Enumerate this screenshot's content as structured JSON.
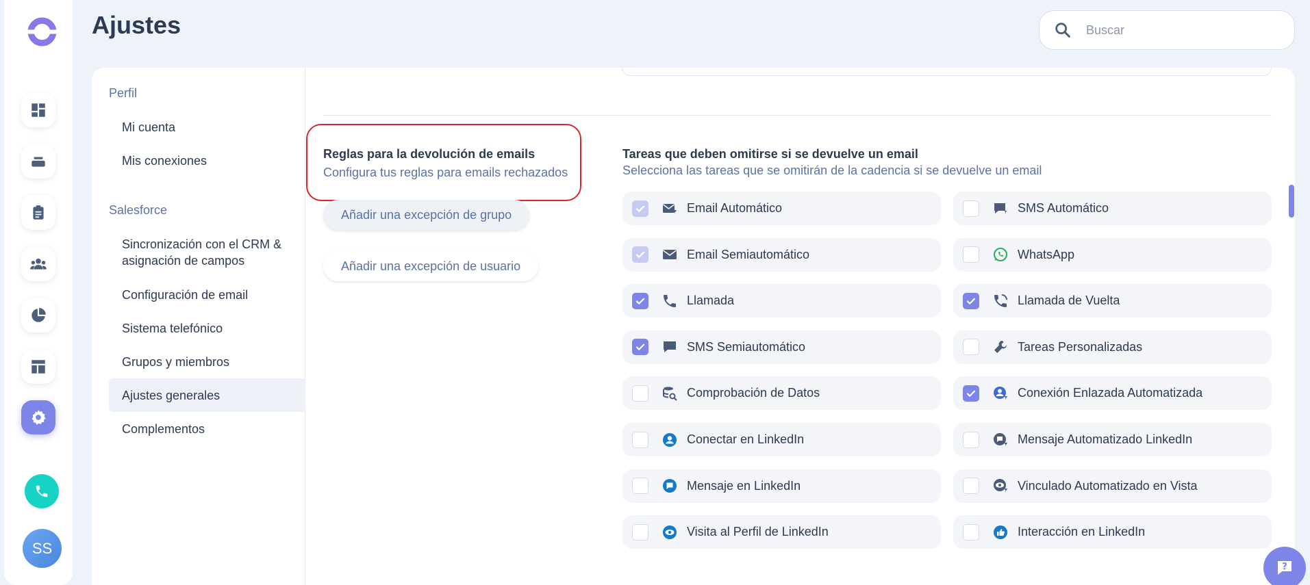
{
  "header": {
    "title": "Ajustes",
    "search_placeholder": "Buscar"
  },
  "rail": {
    "avatar_initials": "SS",
    "icons": [
      "dashboard-icon",
      "inbox-icon",
      "clipboard-icon",
      "people-icon",
      "pie-chart-icon",
      "layout-icon",
      "gear-icon"
    ]
  },
  "sidebar": {
    "sections": [
      {
        "title": "Perfil",
        "items": [
          "Mi cuenta",
          "Mis conexiones"
        ]
      },
      {
        "title": "Salesforce",
        "items": [
          "Sincronización con el CRM & asignación de campos",
          "Configuración de email",
          "Sistema telefónico",
          "Grupos y miembros",
          "Ajustes generales",
          "Complementos"
        ]
      }
    ],
    "active_item": "Ajustes generales"
  },
  "rules": {
    "title": "Reglas para la devolución de emails",
    "subtitle": "Configura tus reglas para emails rechazados",
    "group_exception": "Añadir una excepción de grupo",
    "user_exception": "Añadir una excepción de usuario"
  },
  "tasks": {
    "title": "Tareas que deben omitirse si se devuelve un email",
    "subtitle": "Selecciona las tareas que se omitirán de la cadencia si se devuelve un email",
    "items": [
      {
        "label": "Email Automático",
        "icon": "auto-email-icon",
        "state": "dim",
        "icon_color": "#4a5b78"
      },
      {
        "label": "SMS Automático",
        "icon": "auto-sms-icon",
        "state": "off",
        "icon_color": "#4a5b78"
      },
      {
        "label": "Email Semiautomático",
        "icon": "email-icon",
        "state": "dim",
        "icon_color": "#4a5b78"
      },
      {
        "label": "WhatsApp",
        "icon": "whatsapp-icon",
        "state": "off",
        "icon_color": "#25b05a"
      },
      {
        "label": "Llamada",
        "icon": "phone-icon",
        "state": "on",
        "icon_color": "#4a5b78"
      },
      {
        "label": "Llamada de Vuelta",
        "icon": "callback-icon",
        "state": "on",
        "icon_color": "#4a5b78"
      },
      {
        "label": "SMS Semiautomático",
        "icon": "sms-icon",
        "state": "on",
        "icon_color": "#4a5b78"
      },
      {
        "label": "Tareas Personalizadas",
        "icon": "wrench-icon",
        "state": "off",
        "icon_color": "#4a5b78"
      },
      {
        "label": "Comprobación de Datos",
        "icon": "data-check-icon",
        "state": "off",
        "icon_color": "#4a5b78"
      },
      {
        "label": "Conexión Enlazada Automatizada",
        "icon": "linkedin-auto-connect-icon",
        "state": "on",
        "icon_color": "#3d6bd0"
      },
      {
        "label": "Conectar en LinkedIn",
        "icon": "linkedin-connect-icon",
        "state": "off",
        "icon_color": "#1479c9"
      },
      {
        "label": "Mensaje Automatizado LinkedIn",
        "icon": "linkedin-auto-message-icon",
        "state": "off",
        "icon_color": "#4a5b78"
      },
      {
        "label": "Mensaje en LinkedIn",
        "icon": "linkedin-message-icon",
        "state": "off",
        "icon_color": "#1479c9"
      },
      {
        "label": "Vinculado Automatizado en Vista",
        "icon": "linkedin-auto-view-icon",
        "state": "off",
        "icon_color": "#4a5b78"
      },
      {
        "label": "Visita al Perfil de LinkedIn",
        "icon": "linkedin-profile-view-icon",
        "state": "off",
        "icon_color": "#1479c9"
      },
      {
        "label": "Interacción en LinkedIn",
        "icon": "linkedin-like-icon",
        "state": "off",
        "icon_color": "#1479c9"
      }
    ]
  },
  "colors": {
    "accent": "#7d86e8",
    "highlight_border": "#d9262e",
    "teal": "#17d3c6"
  }
}
